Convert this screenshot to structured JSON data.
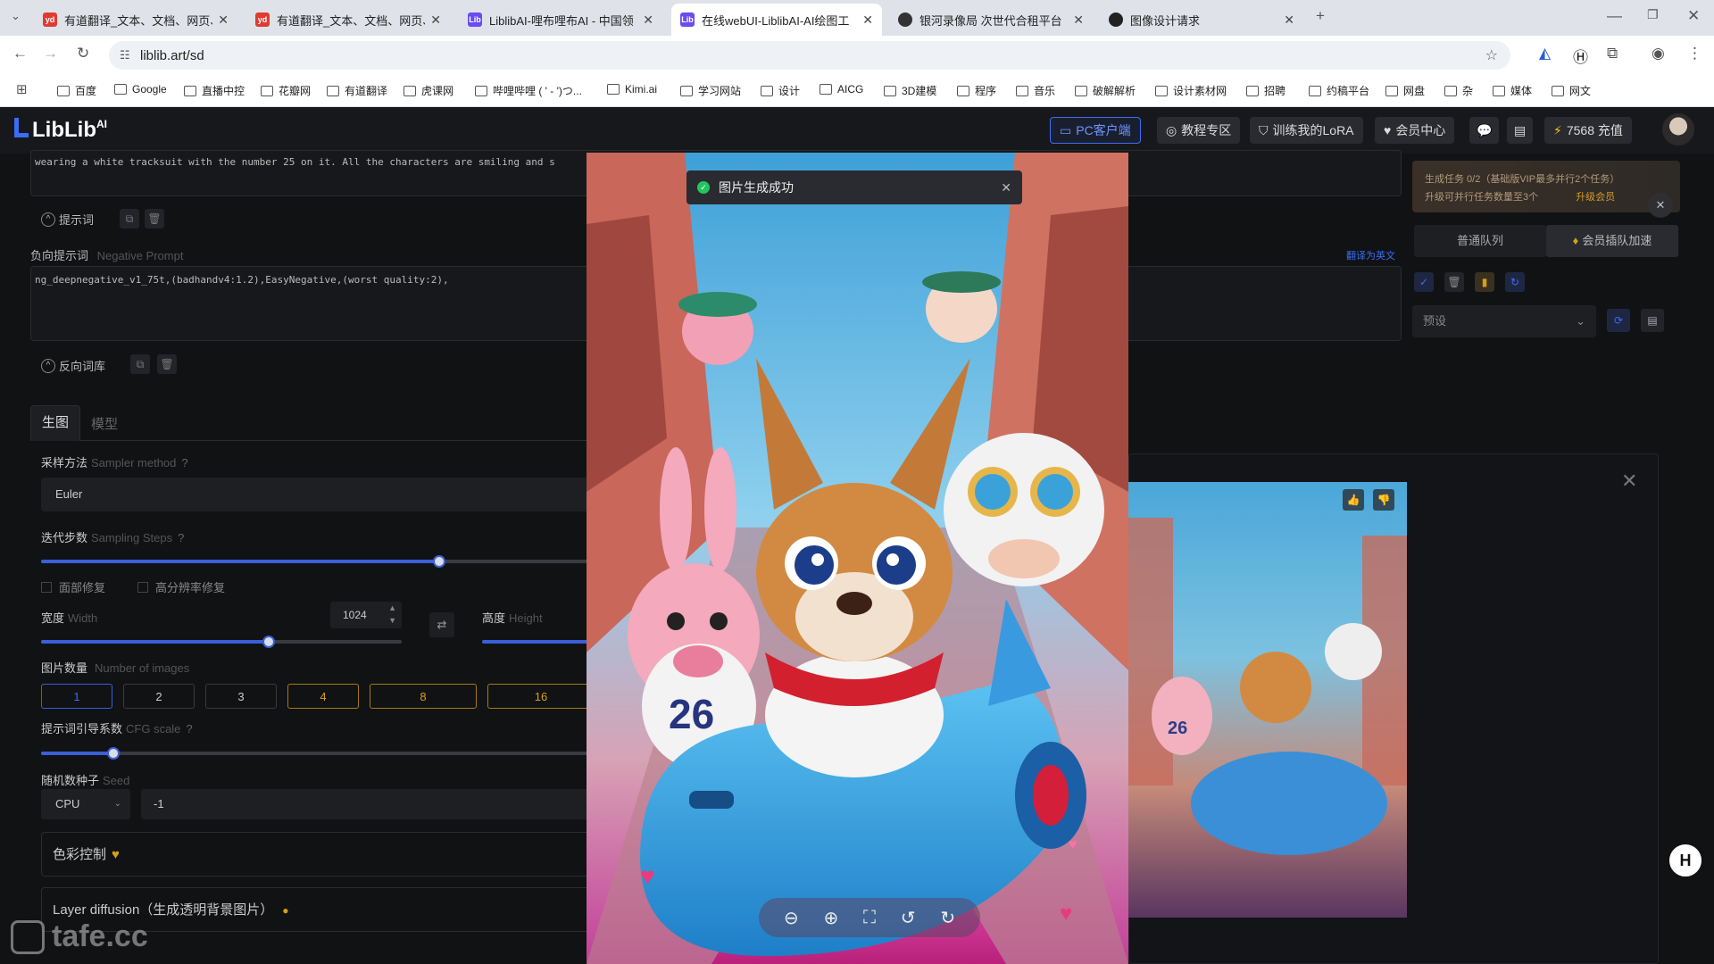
{
  "browser": {
    "tabs": [
      {
        "title": "有道翻译_文本、文档、网页、",
        "favicon": "yd",
        "color": "#e03b32"
      },
      {
        "title": "有道翻译_文本、文档、网页、",
        "favicon": "yd",
        "color": "#e03b32"
      },
      {
        "title": "LiblibAI-哩布哩布AI - 中国领",
        "favicon": "Lib",
        "color": "#6a4cf0"
      },
      {
        "title": "在线webUI-LiblibAI-AI绘图工",
        "favicon": "Lib",
        "color": "#6a4cf0"
      },
      {
        "title": "银河录像局 次世代合租平台",
        "favicon": "",
        "color": "#333"
      },
      {
        "title": "图像设计请求",
        "favicon": "",
        "color": "#222"
      }
    ],
    "url": "liblib.art/sd",
    "bookmarks": [
      "百度",
      "Google",
      "直播中控",
      "花瓣网",
      "有道翻译",
      "虎课网",
      "哔哩哔哩 ( ' - ')つ...",
      "Kimi.ai",
      "学习网站",
      "设计",
      "AICG",
      "3D建模",
      "程序",
      "音乐",
      "破解解析",
      "设计素材网",
      "招聘",
      "约稿平台",
      "网盘",
      "杂",
      "媒体",
      "网文"
    ]
  },
  "app": {
    "logo": "LibLib",
    "logo_sup": "AI",
    "header_buttons": [
      "PC客户端",
      "教程专区",
      "训练我的LoRA",
      "会员中心"
    ],
    "credits": "7568 充值"
  },
  "left_panel": {
    "prompt_text": "wearing a white tracksuit with the number 25 on it. All the characters are smiling and s",
    "prompt_section": "提示词",
    "neg_label_cn": "负向提示词",
    "neg_label_en": "Negative Prompt",
    "translate_link": "翻译为英文",
    "neg_text": "ng_deepnegative_v1_75t,(badhandv4:1.2),EasyNegative,(worst quality:2),",
    "neg_library": "反向词库",
    "tabs": [
      "生图",
      "模型"
    ],
    "sampler_cn": "采样方法",
    "sampler_en": "Sampler method",
    "sampler_value": "Euler",
    "steps_cn": "迭代步数",
    "steps_en": "Sampling Steps",
    "steps_fraction": 0.72,
    "face_fix": "面部修复",
    "hires_fix": "高分辨率修复",
    "width_cn": "宽度",
    "width_en": "Width",
    "width_value": "1024",
    "width_fraction": 0.63,
    "height_cn": "高度",
    "height_en": "Height",
    "num_images_cn": "图片数量",
    "num_images_en": "Number of images",
    "num_options": [
      "1",
      "2",
      "3",
      "4",
      "8",
      "16"
    ],
    "cfg_cn": "提示词引导系数",
    "cfg_en": "CFG scale",
    "cfg_fraction": 0.13,
    "seed_cn": "随机数种子",
    "seed_en": "Seed",
    "seed_device": "CPU",
    "seed_value": "-1",
    "color_control": "色彩控制",
    "layer_diffusion": "Layer diffusion（生成透明背景图片）"
  },
  "right_panel": {
    "task_line1": "生成任务 0/2（基础版VIP最多并行2个任务）",
    "task_line2": "升级可并行任务数量至3个",
    "task_upgrade": "升级会员",
    "queue_normal": "普通队列",
    "queue_vip": "会员插队加速",
    "preset_placeholder": "预设"
  },
  "modal": {
    "toast": "图片生成成功"
  },
  "watermark": "tafe.cc",
  "colors": {
    "accent": "#3b5fd9",
    "gold": "#d4a017",
    "success": "#22c55e"
  }
}
